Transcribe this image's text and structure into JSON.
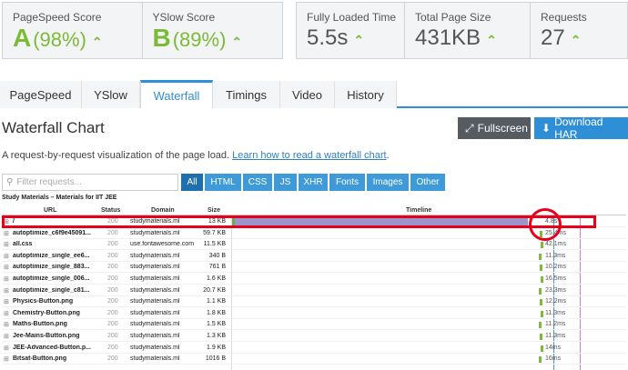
{
  "scores": {
    "pagespeed": {
      "label": "PageSpeed Score",
      "grade": "A",
      "value": "(98%)"
    },
    "yslow": {
      "label": "YSlow Score",
      "grade": "B",
      "value": "(89%)"
    },
    "loaded": {
      "label": "Fully Loaded Time",
      "value": "5.5s"
    },
    "size": {
      "label": "Total Page Size",
      "value": "431KB"
    },
    "requests": {
      "label": "Requests",
      "value": "27"
    },
    "colors": {
      "good": "#7cbb36"
    }
  },
  "tabs": [
    "PageSpeed",
    "YSlow",
    "Waterfall",
    "Timings",
    "Video",
    "History"
  ],
  "active_tab": "Waterfall",
  "header": {
    "title": "Waterfall Chart",
    "fullscreen": "Fullscreen",
    "download": "Download HAR",
    "description": "A request-by-request visualization of the page load.",
    "learn_link": "Learn how to read a waterfall chart",
    "learn_suffix": "."
  },
  "filter": {
    "placeholder": "Filter requests...",
    "types": [
      "All",
      "HTML",
      "CSS",
      "JS",
      "XHR",
      "Fonts",
      "Images",
      "Other"
    ],
    "active": "All"
  },
  "table": {
    "site_title": "Study Materials – Materials for IIT JEE",
    "columns": {
      "url": "URL",
      "status": "Status",
      "domain": "Domain",
      "size": "Size",
      "timeline": "Timeline"
    },
    "rows": [
      {
        "url": "/",
        "status": "200",
        "domain": "studymaterials.ml",
        "size": "13 KB",
        "time": "4.8s"
      },
      {
        "url": "autoptimize_c6f9e45091...",
        "status": "200",
        "domain": "studymaterials.ml",
        "size": "59.7 KB",
        "time": "25.4ms"
      },
      {
        "url": "all.css",
        "status": "200",
        "domain": "use.fontawesome.com",
        "size": "11.5 KB",
        "time": "42.1ms"
      },
      {
        "url": "autoptimize_single_ee6...",
        "status": "200",
        "domain": "studymaterials.ml",
        "size": "340 B",
        "time": "11.3ms"
      },
      {
        "url": "autoptimize_single_883...",
        "status": "200",
        "domain": "studymaterials.ml",
        "size": "761 B",
        "time": "10.2ms"
      },
      {
        "url": "autoptimize_single_006...",
        "status": "200",
        "domain": "studymaterials.ml",
        "size": "1.6 KB",
        "time": "16.5ms"
      },
      {
        "url": "autoptimize_single_c81...",
        "status": "200",
        "domain": "studymaterials.ml",
        "size": "20.7 KB",
        "time": "23.3ms"
      },
      {
        "url": "Physics-Button.png",
        "status": "200",
        "domain": "studymaterials.ml",
        "size": "1.1 KB",
        "time": "12.2ms"
      },
      {
        "url": "Chemistry-Button.png",
        "status": "200",
        "domain": "studymaterials.ml",
        "size": "1.8 KB",
        "time": "11.3ms"
      },
      {
        "url": "Maths-Button.png",
        "status": "200",
        "domain": "studymaterials.ml",
        "size": "1.5 KB",
        "time": "11.2ms"
      },
      {
        "url": "Jee-Mains-Button.png",
        "status": "200",
        "domain": "studymaterials.ml",
        "size": "1.3 KB",
        "time": "11.3ms"
      },
      {
        "url": "JEE-Advanced-Button.p...",
        "status": "200",
        "domain": "studymaterials.ml",
        "size": "1.9 KB",
        "time": "14ms"
      },
      {
        "url": "Bitsat-Button.png",
        "status": "200",
        "domain": "studymaterials.ml",
        "size": "1016 B",
        "time": "16ms"
      }
    ]
  }
}
